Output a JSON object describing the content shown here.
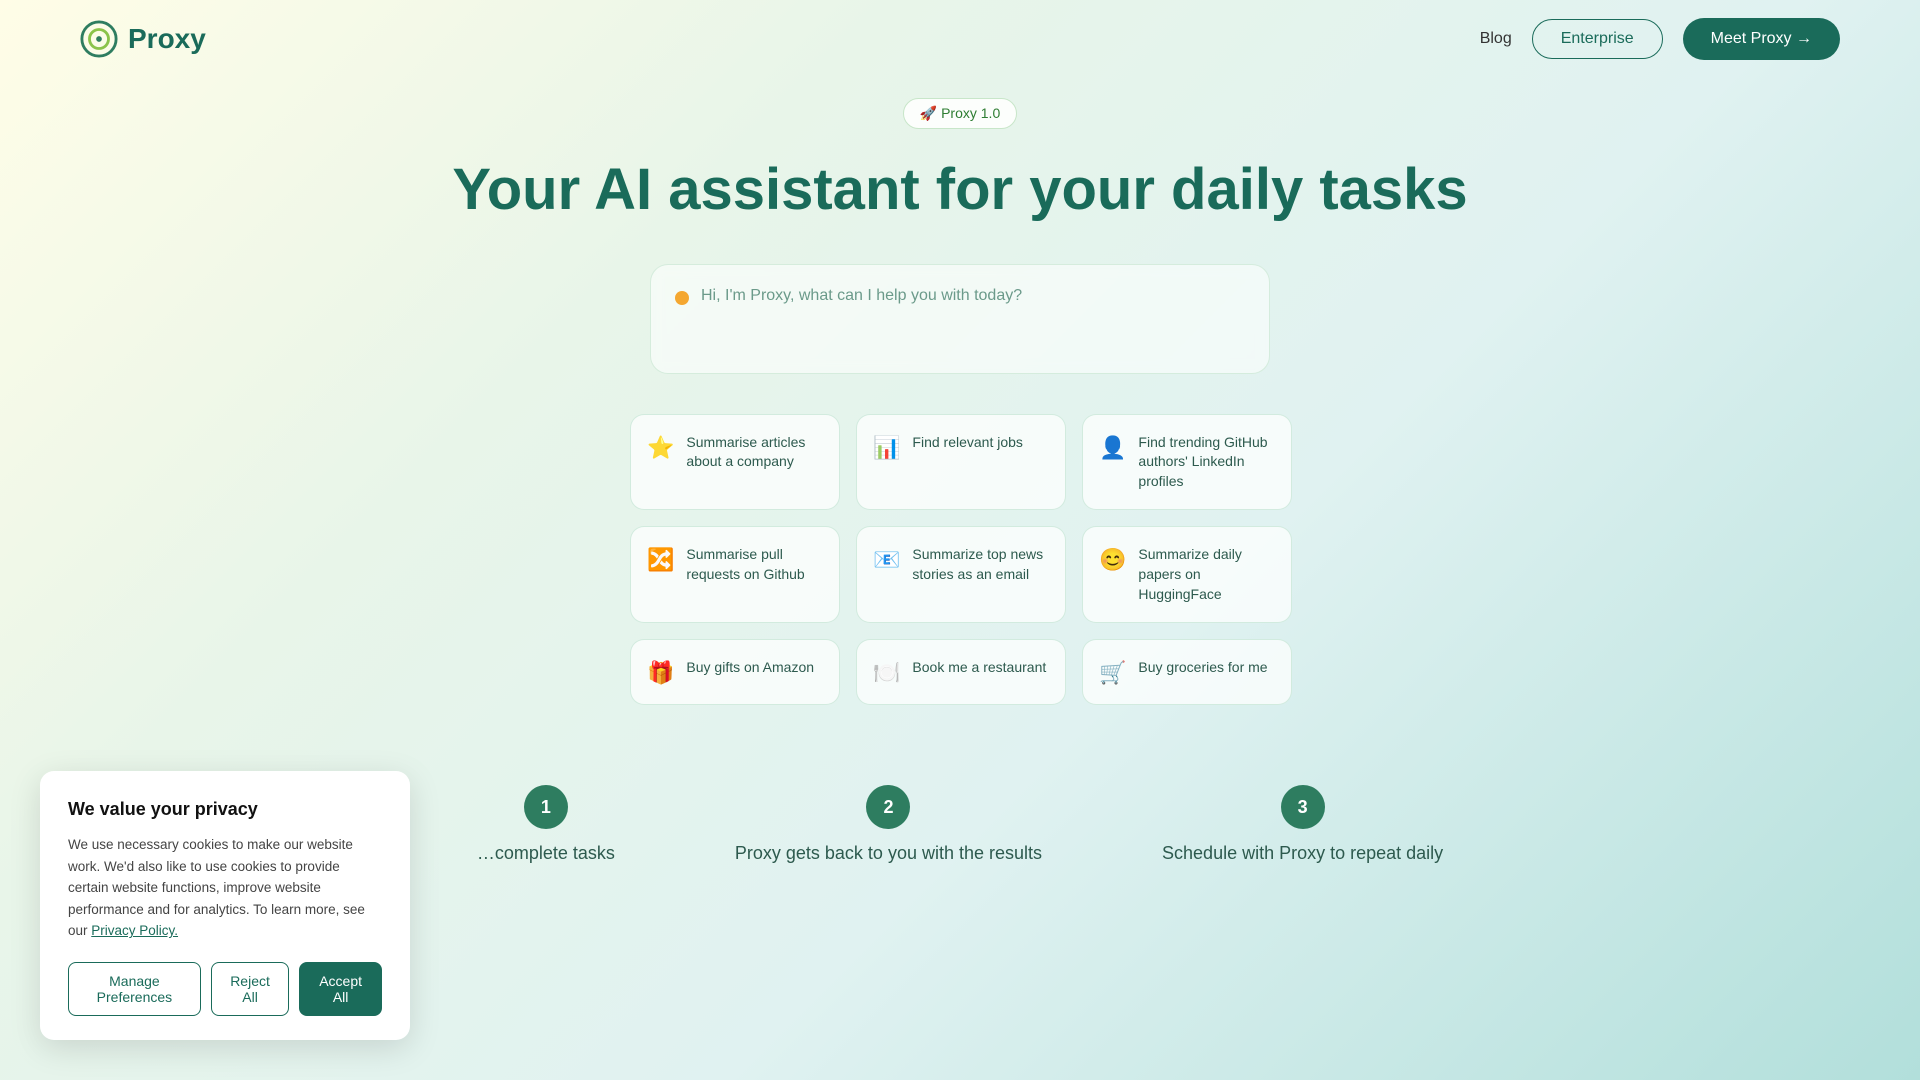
{
  "header": {
    "logo_text": "Proxy",
    "nav": {
      "blog_label": "Blog",
      "enterprise_label": "Enterprise",
      "meet_proxy_label": "Meet Proxy →"
    }
  },
  "hero": {
    "version_badge": "🚀 Proxy 1.0",
    "title": "Your AI assistant for your daily tasks",
    "chat_placeholder": "Hi, I'm Proxy, what can I help you with today?"
  },
  "action_cards": [
    {
      "icon": "⭐",
      "text": "Summarise articles about a company"
    },
    {
      "icon": "📊",
      "text": "Find relevant jobs"
    },
    {
      "icon": "👤",
      "text": "Find trending GitHub authors' LinkedIn profiles"
    },
    {
      "icon": "🔀",
      "text": "Summarise pull requests on Github"
    },
    {
      "icon": "📧",
      "text": "Summarize top news stories as an email"
    },
    {
      "icon": "😊",
      "text": "Summarize daily papers on HuggingFace"
    },
    {
      "icon": "🎁",
      "text": "Buy gifts on Amazon"
    },
    {
      "icon": "🍽️",
      "text": "Book me a restaurant"
    },
    {
      "icon": "🛒",
      "text": "Buy groceries for me"
    }
  ],
  "steps": [
    {
      "number": "1",
      "text": "…complete tasks"
    },
    {
      "number": "2",
      "text": "Proxy gets back to you with the results"
    },
    {
      "number": "3",
      "text": "Schedule with Proxy to repeat daily"
    }
  ],
  "cookie_banner": {
    "title": "We value your privacy",
    "body": "We use necessary cookies to make our website work. We'd also like to use cookies to provide certain website functions, improve website performance and for analytics. To learn more, see our ",
    "privacy_policy_link": "Privacy Policy.",
    "manage_pref_label": "Manage Preferences",
    "reject_all_label": "Reject All",
    "accept_all_label": "Accept All"
  }
}
